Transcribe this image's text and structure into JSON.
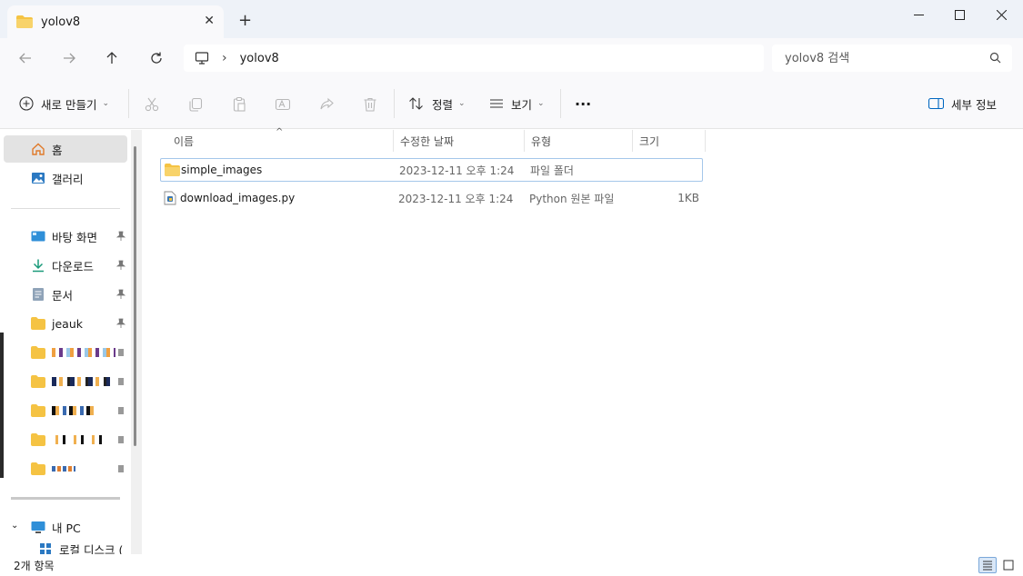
{
  "window": {
    "tab_title": "yolov8",
    "new_tab_symbol": "+",
    "close_tab_symbol": "✕"
  },
  "address": {
    "crumbs": [
      "yolov8"
    ]
  },
  "search": {
    "placeholder": "yolov8 검색"
  },
  "toolbar": {
    "new_label": "새로 만들기",
    "sort_label": "정렬",
    "view_label": "보기",
    "more_label": "···",
    "details_label": "세부 정보"
  },
  "sidebar": {
    "items": [
      {
        "label": "홈",
        "icon": "home-icon"
      },
      {
        "label": "갤러리",
        "icon": "gallery-icon"
      },
      {
        "label": "바탕 화면",
        "icon": "desktop-icon",
        "pinned": true
      },
      {
        "label": "다운로드",
        "icon": "download-icon",
        "pinned": true
      },
      {
        "label": "문서",
        "icon": "document-icon",
        "pinned": true
      },
      {
        "label": "jeauk",
        "icon": "folder-icon",
        "pinned": true
      }
    ],
    "this_pc_label": "내 PC",
    "partial_label": "로컬 디스크 ("
  },
  "columns": [
    "이름",
    "수정한 날짜",
    "유형",
    "크기"
  ],
  "files": [
    {
      "name": "simple_images",
      "date": "2023-12-11 오후 1:24",
      "type": "파일 폴더",
      "size": "",
      "icon": "folder-icon"
    },
    {
      "name": "download_images.py",
      "date": "2023-12-11 오후 1:24",
      "type": "Python 원본 파일",
      "size": "1KB",
      "icon": "python-file-icon"
    }
  ],
  "status": {
    "count": "2개 항목"
  },
  "colors": {
    "folder": "#f5c343",
    "accent": "#0067c0",
    "selection": "#a5c7ea"
  }
}
